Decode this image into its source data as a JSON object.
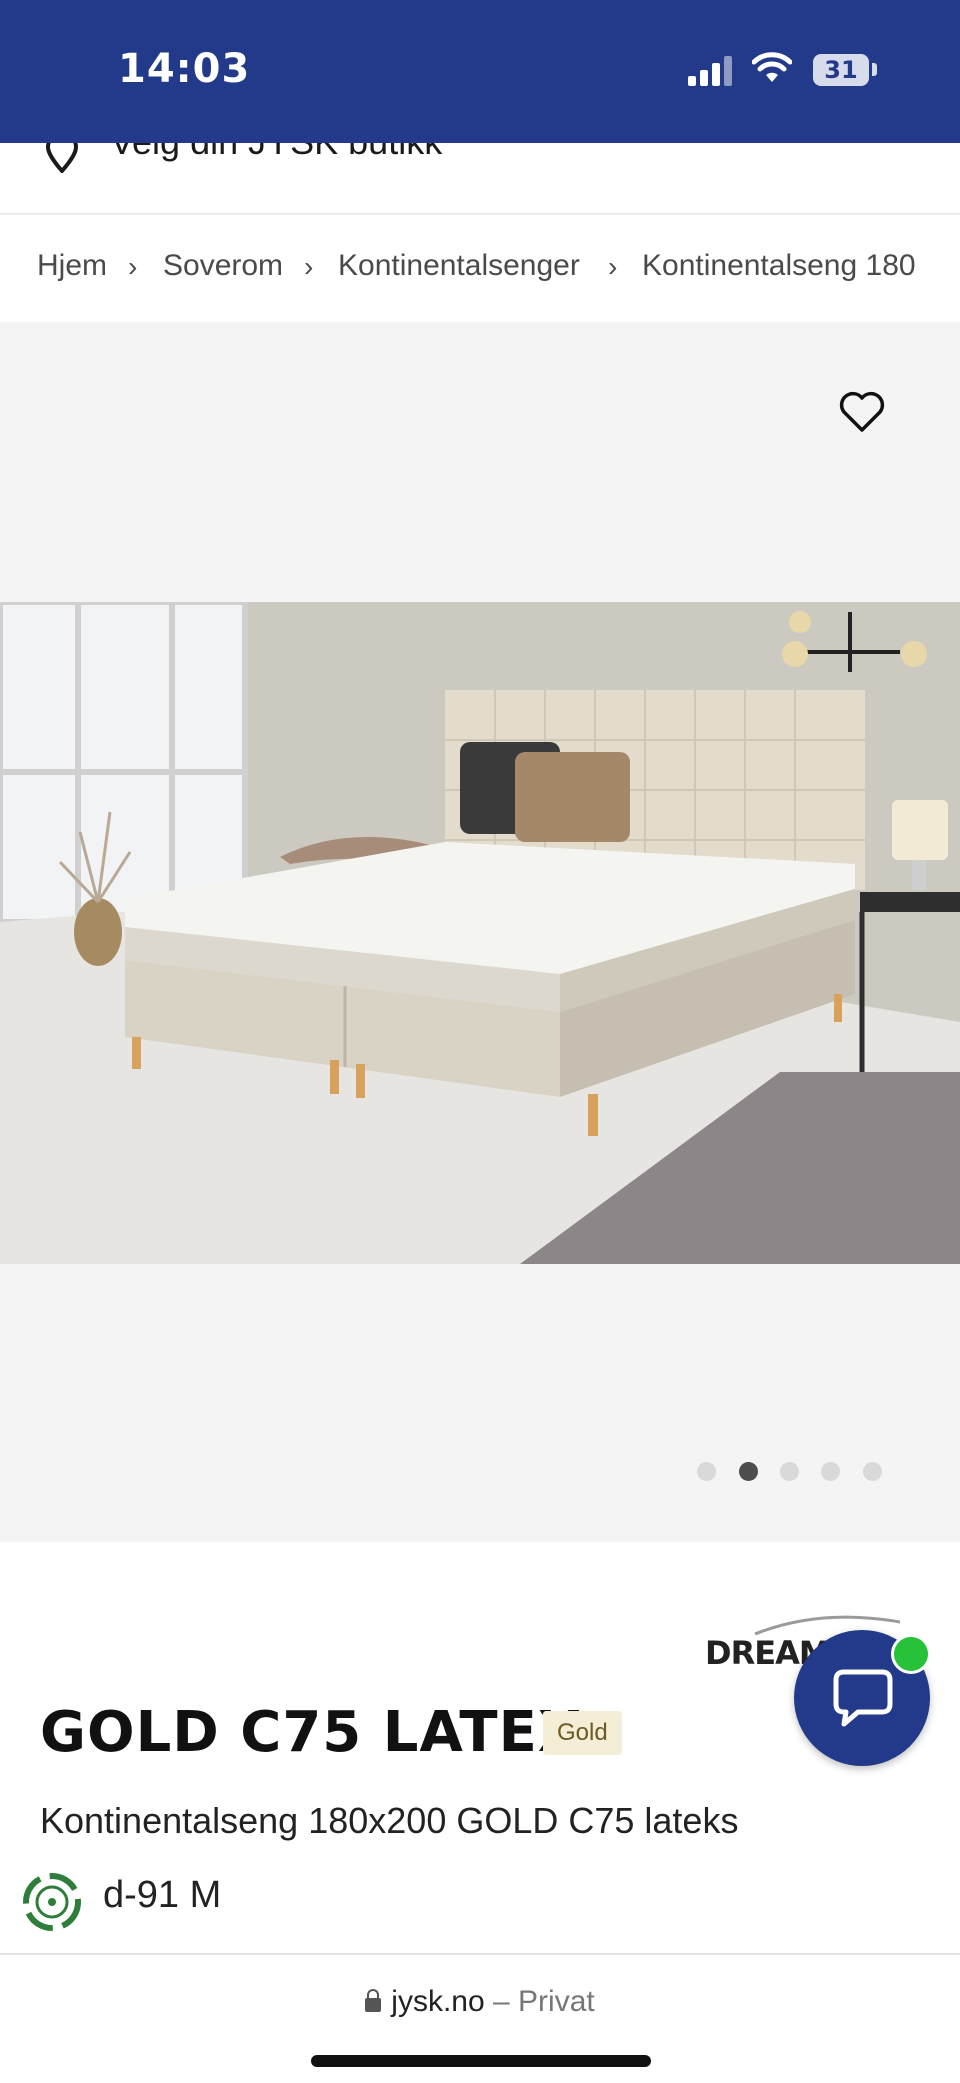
{
  "status": {
    "time": "14:03",
    "battery": "31"
  },
  "store": {
    "label": "Velg din JYSK butikk"
  },
  "breadcrumb": [
    "Hjem",
    "Soverom",
    "Kontinentalsenger",
    "Kontinentalseng 180"
  ],
  "gallery": {
    "dot_count": 5,
    "active_dot": 1
  },
  "product": {
    "brand": "DREAM",
    "title": "GOLD C75 LATEX",
    "badge": "Gold",
    "subtitle": "Kontinentalseng 180x200 GOLD C75 lateks",
    "spec": "d-91 M"
  },
  "browser": {
    "domain": "jysk.no",
    "separator": "–",
    "mode": "Privat"
  },
  "colors": {
    "brand_blue": "#233a8a",
    "online_green": "#27c23a",
    "badge_bg": "#f5eed6"
  },
  "icons": [
    "location-pin-icon",
    "chevron-right-icon",
    "heart-icon",
    "chat-bubble-icon",
    "recycle-icon",
    "lock-icon"
  ]
}
